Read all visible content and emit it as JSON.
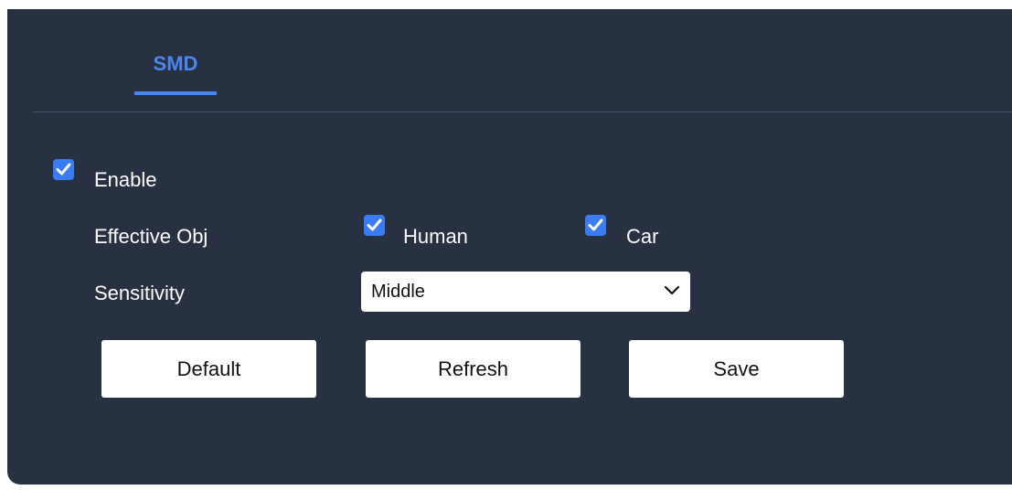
{
  "tabs": [
    {
      "label": "SMD",
      "active": true
    }
  ],
  "form": {
    "enable": {
      "label": "Enable",
      "checked": true
    },
    "effective_obj": {
      "label": "Effective Obj",
      "options": [
        {
          "label": "Human",
          "checked": true
        },
        {
          "label": "Car",
          "checked": true
        }
      ]
    },
    "sensitivity": {
      "label": "Sensitivity",
      "value": "Middle"
    }
  },
  "buttons": {
    "default_label": "Default",
    "refresh_label": "Refresh",
    "save_label": "Save"
  },
  "icons": {
    "checkbox": "check-icon",
    "select": "chevron-down-icon"
  },
  "colors": {
    "panel_background": "#283142",
    "accent": "#4b86ef",
    "checkbox": "#3b7cf4",
    "divider": "#4d5668"
  }
}
